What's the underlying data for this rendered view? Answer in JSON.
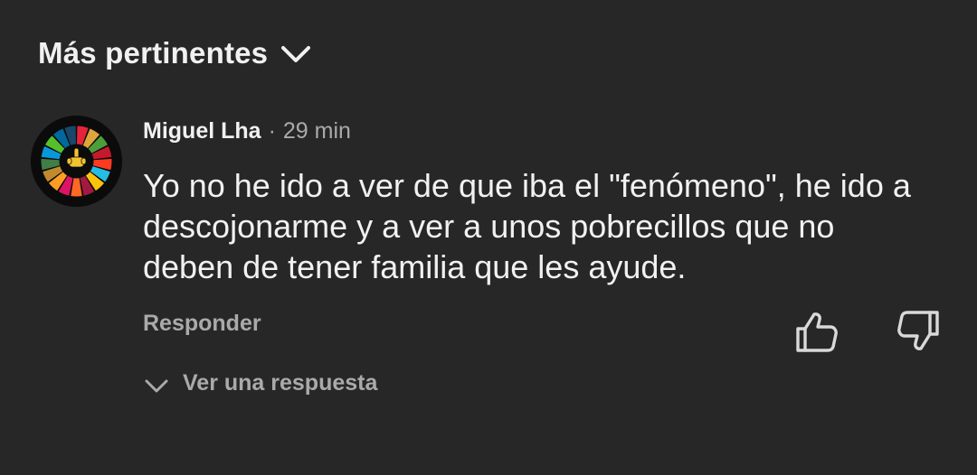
{
  "sort": {
    "label": "Más pertinentes",
    "icon": "chevron-down-icon"
  },
  "comment": {
    "author": "Miguel Lha",
    "separator": "·",
    "time": "29 min",
    "text_lines": [
      "Yo no he ido a ver de que iba el \"fenómeno\", he ido a",
      "descojonarme y a ver a unos pobrecillos que no",
      "deben de tener familia que les ayude."
    ],
    "avatar_icon": "sdg-wheel-middle-finger-avatar",
    "reply_label": "Responder",
    "like_icon": "thumb-up-icon",
    "dislike_icon": "thumb-down-icon",
    "view_replies_label": "Ver una respuesta",
    "view_replies_icon": "chevron-down-icon"
  },
  "colors": {
    "background": "#272727",
    "primary_text": "#f1f1f1",
    "secondary_text": "#aaaaaa"
  }
}
